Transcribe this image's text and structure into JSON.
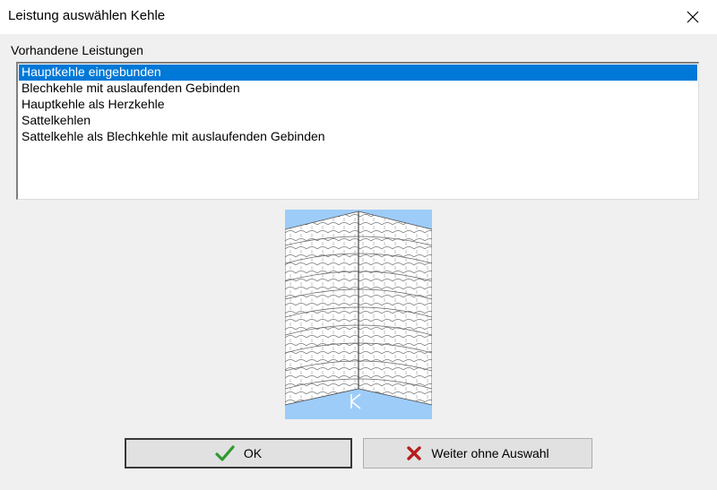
{
  "window": {
    "title": "Leistung auswählen Kehle",
    "close_icon": "close-icon"
  },
  "list": {
    "label": "Vorhandene Leistungen",
    "items": [
      "Hauptkehle eingebunden",
      "Blechkehle mit auslaufenden Gebinden",
      "Hauptkehle als Herzkehle",
      "Sattelkehlen",
      "Sattelkehle als Blechkehle mit auslaufenden Gebinden"
    ],
    "selected_index": 0
  },
  "preview": {
    "image": "roof-valley-tiles-preview",
    "background": "#9dccf9"
  },
  "buttons": {
    "ok": {
      "label": "OK",
      "icon": "checkmark-icon",
      "icon_color": "#2e9a2e"
    },
    "weiter": {
      "label": "Weiter ohne Auswahl",
      "icon": "x-icon",
      "icon_color": "#b71c1c"
    }
  },
  "colors": {
    "selection": "#0078d7",
    "dialog_bg": "#f0f0f0"
  }
}
